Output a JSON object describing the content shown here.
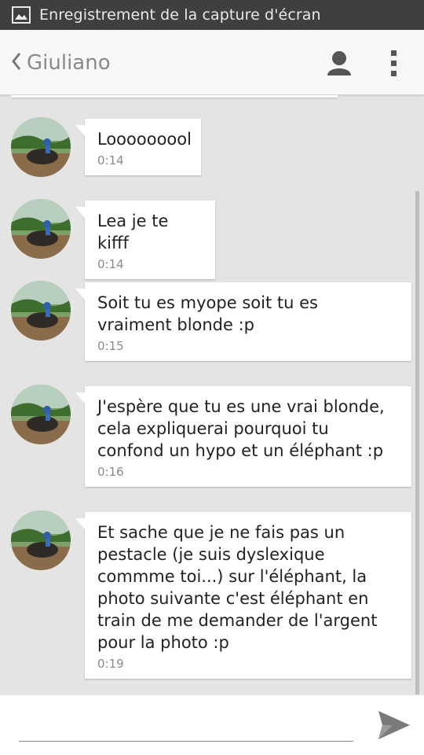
{
  "status_bar": {
    "title": "Enregistrement de la capture d'écran",
    "icon": "image-icon"
  },
  "header": {
    "contact_name": "Giuliano",
    "back_icon": "chevron-left-icon",
    "contact_icon": "person-icon",
    "menu_icon": "overflow-menu-icon"
  },
  "messages": [
    {
      "text": "Looooooool",
      "time": "0:14"
    },
    {
      "text": "Lea je te kifff",
      "time": "0:14"
    },
    {
      "text": "Soit tu es myope soit tu es\nvraiment blonde :p",
      "time": "0:15"
    },
    {
      "text": "J'espère que tu es une vrai blonde,\ncela expliquerai pourquoi tu\nconfond un hypo et un éléphant :p",
      "time": "0:16"
    },
    {
      "text": "Et sache que je ne fais pas un\npestacle (je suis dyslexique\ncommme toi...) sur l'éléphant, la\nphoto suivante c'est éléphant en\ntrain de me demander de l'argent\npour la photo  :p",
      "time": "0:19"
    }
  ],
  "composer": {
    "placeholder": "",
    "value": "",
    "send_icon": "send-icon"
  },
  "colors": {
    "status_bar": "#3f3f3f",
    "app_bar": "#f7f7f7",
    "background": "#e4e4e4",
    "bubble": "#ffffff",
    "send": "#7a7a7a"
  }
}
